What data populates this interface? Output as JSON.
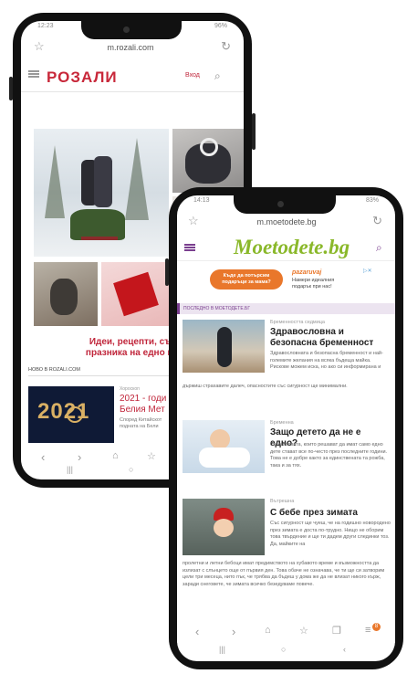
{
  "back_phone": {
    "status_time": "12:23",
    "status_right": "96%",
    "url": "m.rozali.com",
    "logo": "РОЗАЛИ",
    "login": "Вход",
    "headline": "Идеи, рецепти, съвети...\nпразника на едно място в",
    "section_label": "НОВО В ROZALI.COM",
    "article_cat": "Хороскоп",
    "article_title": "2021 - годи\nБелия Мет",
    "article_text": "Според Китайскот\nподната на Бели",
    "banner_year": "2021"
  },
  "front_phone": {
    "status_time": "14:13",
    "status_right": "83%",
    "url": "m.moetodete.bg",
    "logo": "Moetodete.bg",
    "ad": {
      "left_text": "Къде да потърсим\nподаръци за мама?",
      "brand": "pazaruvaj",
      "right_text": "Намери идеалния\nподарък при нас!"
    },
    "section_label": "ПОСЛЕДНО В МОЕТОДЕТЕ.БГ",
    "articles": [
      {
        "cat": "Бременността седмица",
        "title": "Здравословна и безопасна бременност",
        "text_side": "Здравословната и безопасна бременност и най-големите желания на всяка бъдеща майка. Рискове можем иска, но ако си информирана и",
        "text_full": "държиш страхавите далеч, опасностите със сигурност ще минимални."
      },
      {
        "cat": "Бременна",
        "title": "Защо детето да не е едно?",
        "text_side": "Семействата, които решават да имат само едно дете стават все по-често през последните години. Това не е добре както за единствената та рожба, така и за тях.",
        "text_full": ""
      },
      {
        "cat": "Вътрешна",
        "title": "С бебе през зимата",
        "text_side": "Със сигурност ще чуеш, че на годишно новородено през зимата е доста по-трудно. Нищо не оборим това твърдение и ще ти дадем други слединки тоз. Да, майките на",
        "text_full": "пролетни и летни бебоци имат предимството на хубавото време и възможността да излизат с слънцето още от първия ден. Това обаче не означава, че ти ще си затворим цели три месеца, нито пък, че трябва да бъдеш у дома же да не влизат никого кърж, заради снеговете, че зимата всичко безедуваме повече."
      }
    ],
    "tabs_badge": "8"
  },
  "colors": {
    "rozali_red": "#c0263b",
    "moe_green": "#8ab82a",
    "moe_purple": "#7a3f8f"
  }
}
